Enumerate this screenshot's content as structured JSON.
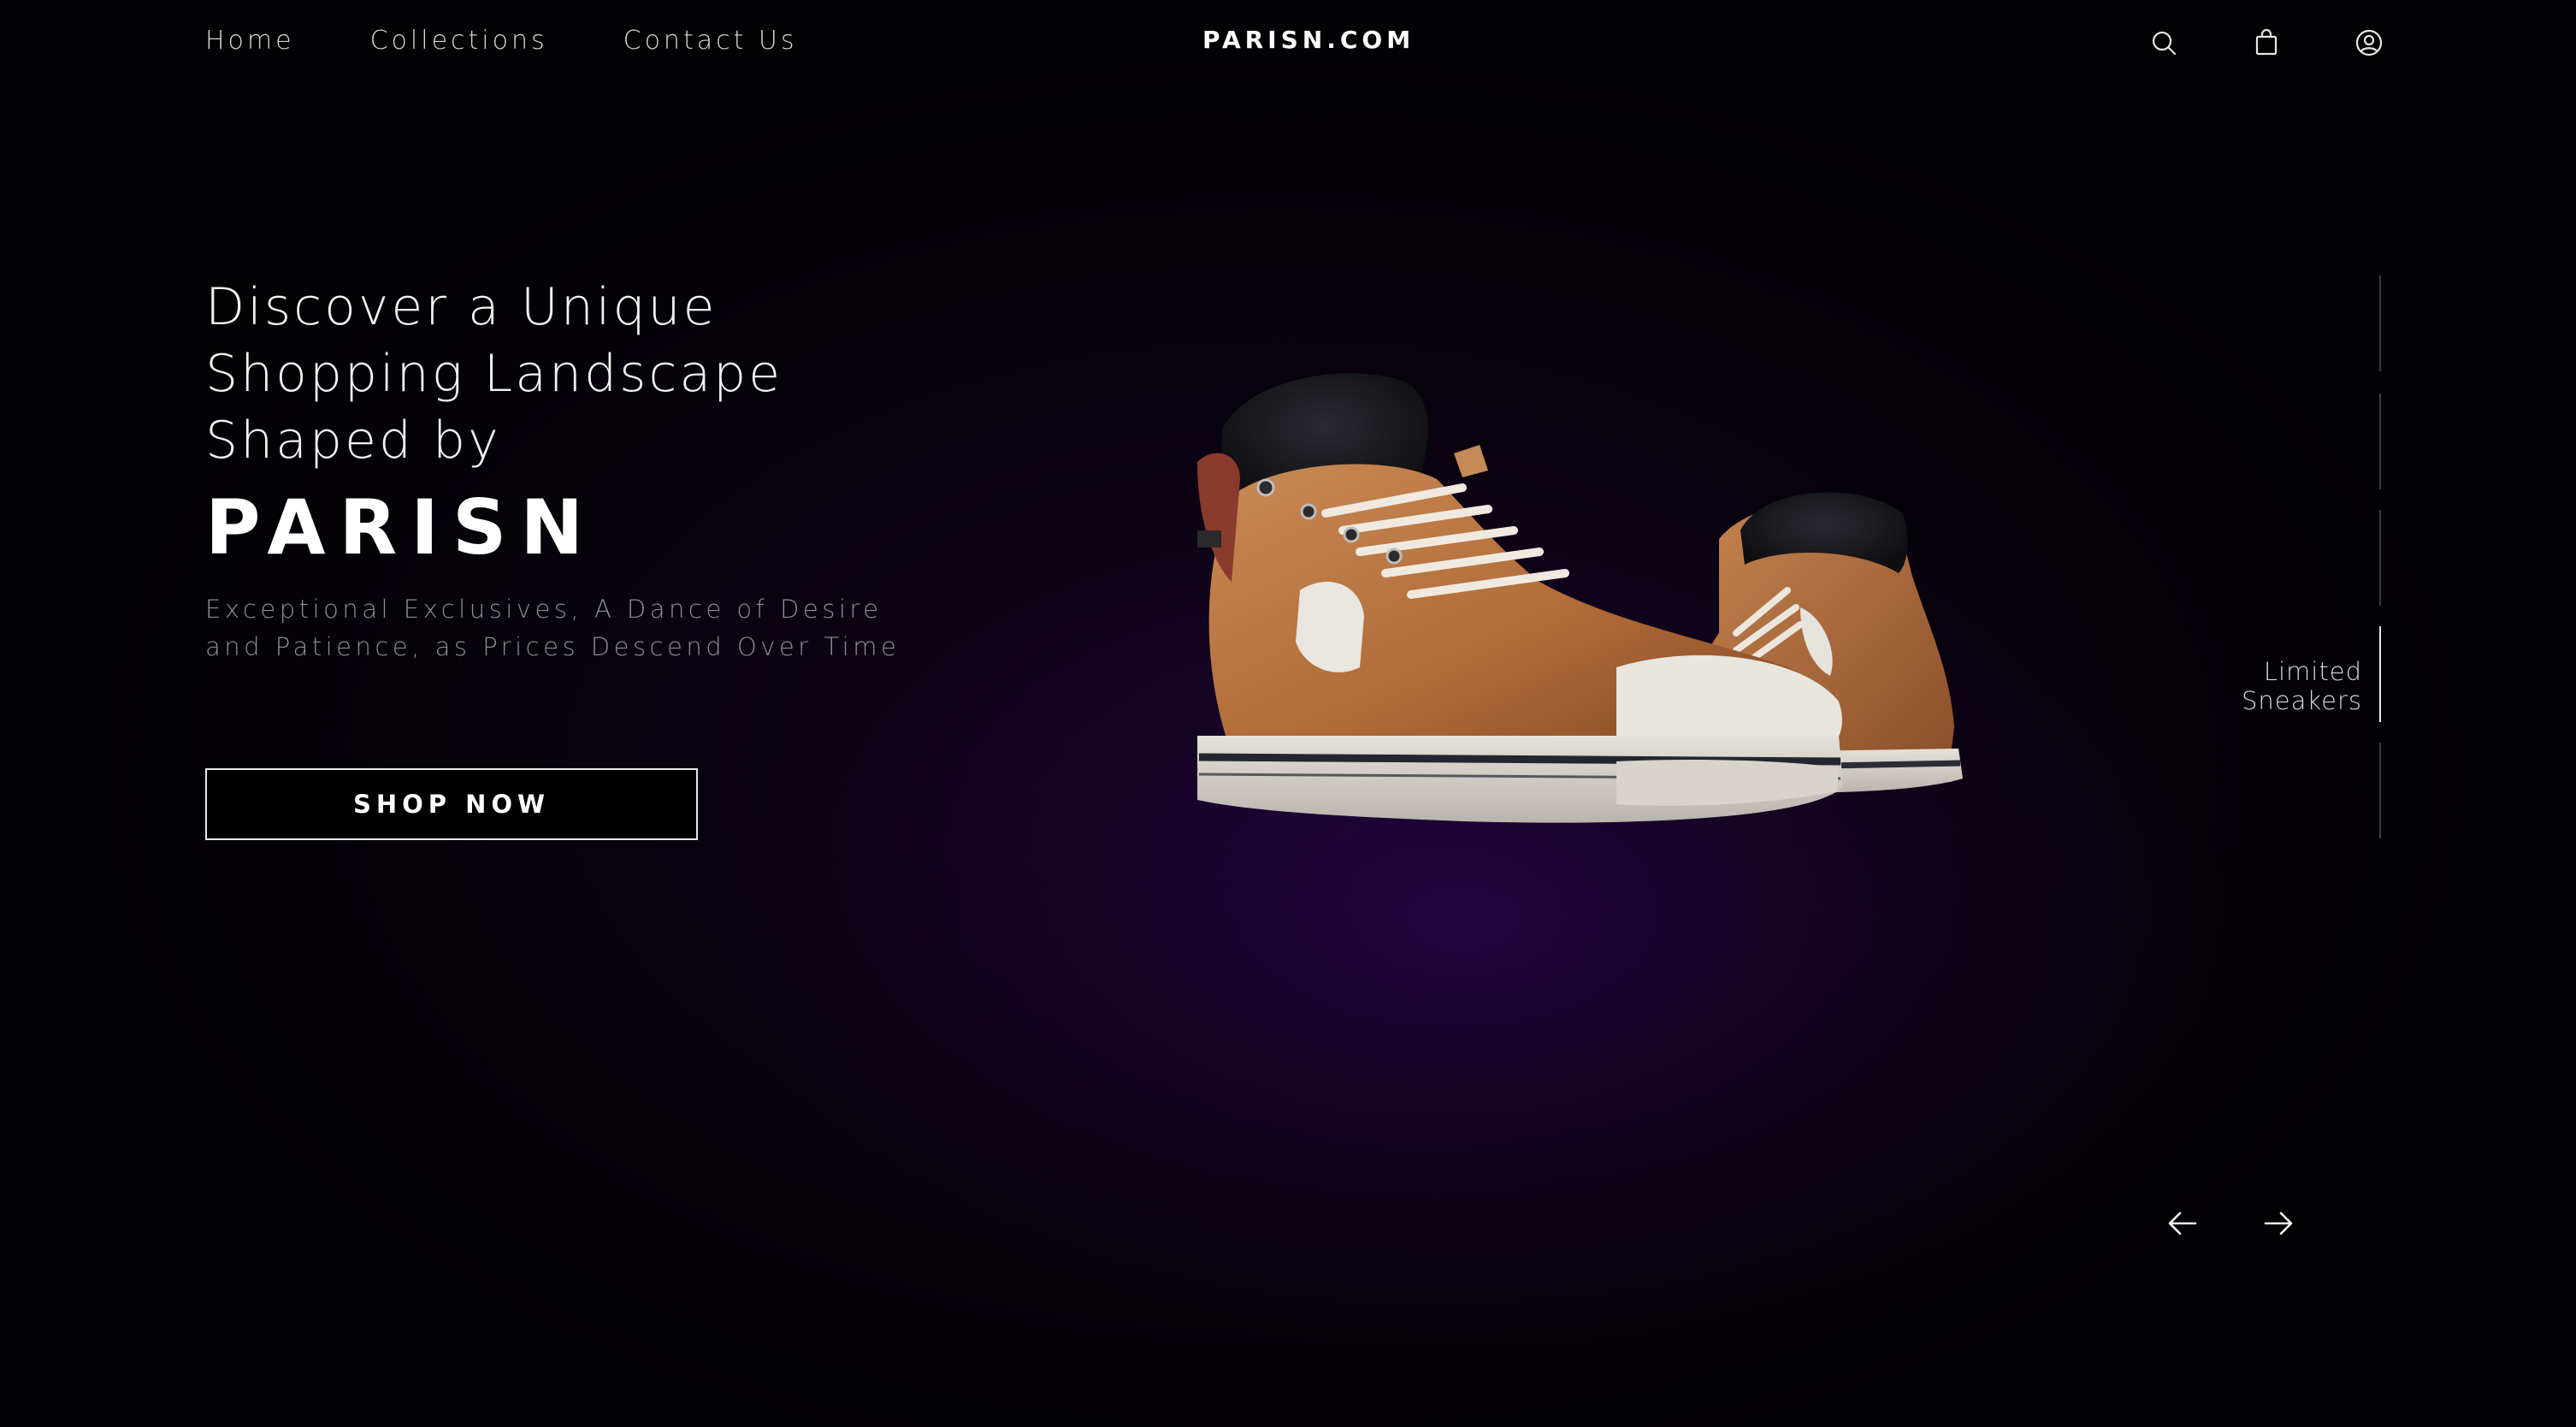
{
  "nav": {
    "links": [
      {
        "label": "Home"
      },
      {
        "label": "Collections"
      },
      {
        "label": "Contact Us"
      }
    ],
    "brand": "PARISN.COM",
    "icons": [
      "search-icon",
      "shopping-bag-icon",
      "user-account-icon"
    ]
  },
  "hero": {
    "heading_lines": [
      "Discover a Unique",
      "Shopping Landscape",
      "Shaped by"
    ],
    "brand_name": "PARISN",
    "subtitle_lines": [
      "Exceptional Exclusives, A Dance of Desire",
      "and Patience, as Prices Descend Over Time"
    ],
    "cta_label": "SHOP NOW"
  },
  "carousel": {
    "slide_count": 5,
    "active_index": 3,
    "active_label": "Limited Sneakers",
    "prev_icon": "arrow-left-icon",
    "next_icon": "arrow-right-icon"
  },
  "colors": {
    "background": "#030205",
    "accent_glow": "#32065c",
    "text_primary": "#ffffff",
    "text_muted": "#8f8f94",
    "shoe_leather": "#b8733f",
    "shoe_collar": "#141418"
  }
}
